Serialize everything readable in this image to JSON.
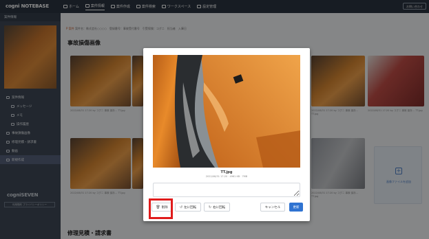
{
  "header": {
    "logo": "cogni NOTEBASE",
    "nav": [
      {
        "label": "ホーム",
        "icon": "home-icon",
        "active": false
      },
      {
        "label": "案件情報",
        "icon": "folder-icon",
        "active": true
      },
      {
        "label": "案件作成",
        "icon": "add-file-icon",
        "active": false
      },
      {
        "label": "案件検索",
        "icon": "search-icon",
        "active": false
      },
      {
        "label": "ワークスペース",
        "icon": "workspace-icon",
        "active": false
      },
      {
        "label": "設定管理",
        "icon": "gear-icon",
        "active": false
      }
    ],
    "user_button": "お問い合わせ"
  },
  "sidebar": {
    "heading": "案件情報",
    "items": [
      {
        "label": "案件情報",
        "icon": "folder-icon"
      },
      {
        "label": "メッセージ",
        "icon": "chat-icon"
      },
      {
        "label": "メモ",
        "icon": "memo-icon"
      },
      {
        "label": "操作履歴",
        "icon": "history-icon"
      },
      {
        "label": "事故損傷画像",
        "icon": "image-icon"
      },
      {
        "label": "修理見積・請求書",
        "icon": "document-icon"
      },
      {
        "label": "動画",
        "icon": "video-icon"
      },
      {
        "label": "新規作成",
        "icon": "plus-icon"
      }
    ],
    "brand": "cogniSEVEN",
    "brand_link": "利用規約 プライバシーポリシー"
  },
  "main": {
    "breadcrumb_first": "P 案件",
    "breadcrumb_rest": "案件名：株式会社○○○○　登録番号：事故受付番号　引受保険：コグニ　担当者　入庫日",
    "section_title": "事故損傷画像",
    "section2_title": "修理見積・請求書",
    "thumb_captions": [
      "2022/08/31 17:20 by コグニ 事故 保存…\nTT.jpg",
      "2022/08/31 17:20 by コグニ 事故 保存…\nTT.jpg",
      "2022/08/31 17:20 by コグニ 事故 保存…\nTT.jpg",
      "2022/08/31 17:20 by コグニ 事故 保存…\nTT.jpg",
      "2022/08/31 17:20 by コグニ 事故 保存…\nTT.jpg",
      "2022/08/31 17:20 by コグニ 事故 保存…\nTT.jpg",
      "2022/08/31 17:20 by コグニ 事故 保存…\nTT.jpg"
    ],
    "add_image_label": "画像ファイルを追加"
  },
  "modal": {
    "filename": "TT.jpg",
    "filemeta": "2022/08/31 17:20 · 4961 KB · 7MB",
    "memo_placeholder": "",
    "delete_label": "削除",
    "rotate_left_label": "左に回転",
    "rotate_right_label": "右に回転",
    "cancel_label": "キャンセル",
    "save_label": "更新",
    "highlight_color": "#e01b1b",
    "save_color": "#2f73d1"
  }
}
